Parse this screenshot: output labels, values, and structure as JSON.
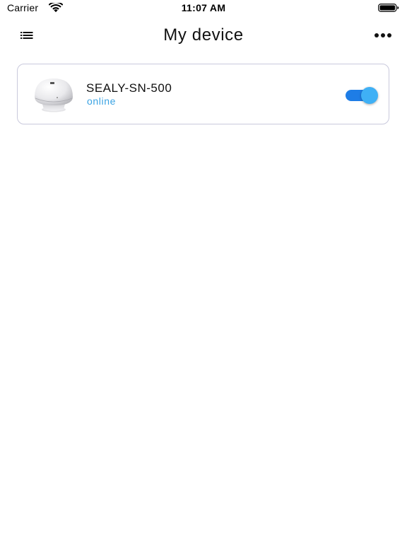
{
  "status_bar": {
    "carrier": "Carrier",
    "time": "11:07 AM",
    "wifi_icon": "wifi-icon",
    "battery_icon": "battery-icon"
  },
  "nav": {
    "title": "My device",
    "menu_icon": "list-menu-icon",
    "more_icon": "more-horizontal-icon"
  },
  "devices": [
    {
      "name": "SEALY-SN-500",
      "status": "online",
      "image": "dome-sensor-device-image",
      "enabled": true
    }
  ],
  "colors": {
    "status_online": "#3aa3e3",
    "toggle_track": "#1e7de6",
    "toggle_knob": "#3fb0f5",
    "card_border": "#c9c9dc"
  }
}
